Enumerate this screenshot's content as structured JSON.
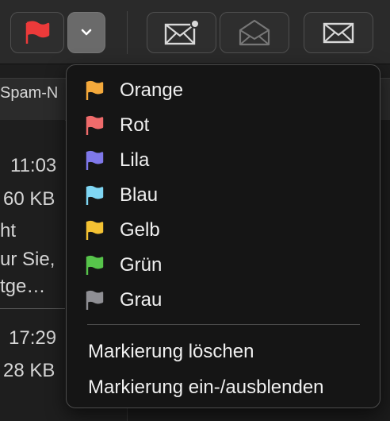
{
  "toolbar": {
    "buttons": [
      {
        "icon": "red-flag-icon",
        "color": "#ec3a3a"
      },
      {
        "icon": "chevron-down-icon"
      },
      {
        "icon": "envelope-unread-icon"
      },
      {
        "icon": "envelope-open-icon"
      },
      {
        "icon": "envelope-icon"
      }
    ]
  },
  "background": {
    "column_header": "Spam-N",
    "rows": [
      {
        "time": "11:03",
        "size": "60 KB",
        "line1": "ht",
        "line2": "ur Sie,",
        "line3": "tge…"
      },
      {
        "time": "17:29",
        "size": "28 KB"
      }
    ]
  },
  "flag_menu": {
    "flags": [
      {
        "label": "Orange",
        "color": "#f4a93b"
      },
      {
        "label": "Rot",
        "color": "#ef6b6b"
      },
      {
        "label": "Lila",
        "color": "#7f78ea"
      },
      {
        "label": "Blau",
        "color": "#7fd6f3"
      },
      {
        "label": "Gelb",
        "color": "#f4c233"
      },
      {
        "label": "Grün",
        "color": "#57c44b"
      },
      {
        "label": "Grau",
        "color": "#8f8f94"
      }
    ],
    "actions": [
      {
        "label": "Markierung löschen"
      },
      {
        "label": "Markierung ein-/ausblenden"
      }
    ]
  }
}
